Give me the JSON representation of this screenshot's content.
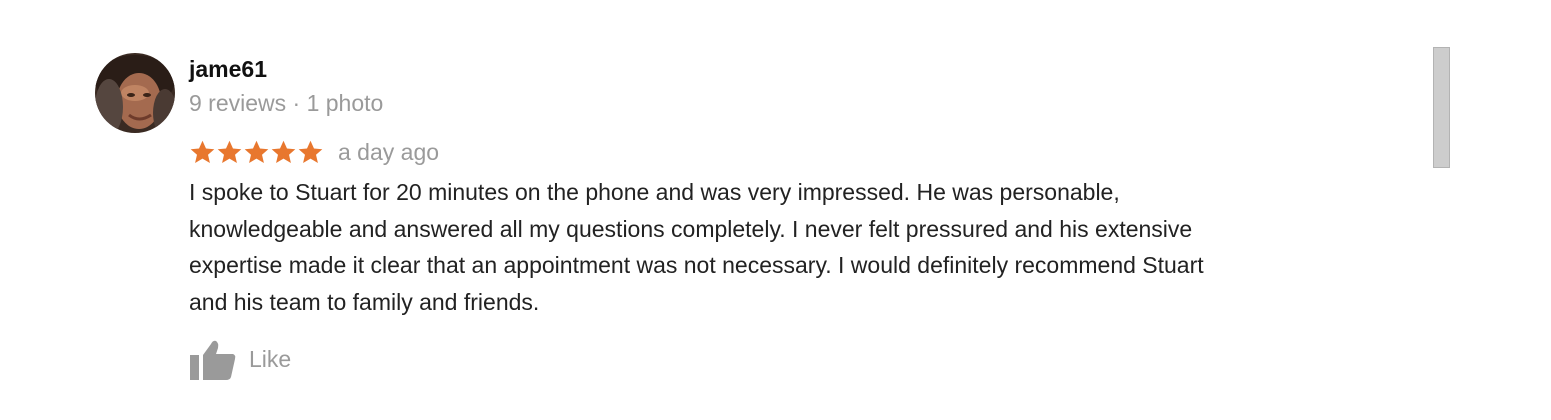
{
  "review": {
    "author_name": "jame61",
    "author_meta": "9 reviews · 1 photo",
    "rating": 5,
    "rating_max": 5,
    "date": "a day ago",
    "text": "I spoke to Stuart for 20 minutes on the phone and was very impressed.  He was personable,\nknowledgeable and answered all my questions completely.  I never felt  pressured and his extensive\nexpertise made it clear that an appointment was not necessary.  I would definitely recommend Stuart\nand his team to family and friends.",
    "like_label": "Like"
  },
  "icons": {
    "avatar": "avatar-photo",
    "star": "star-icon",
    "like": "thumbs-up-icon"
  },
  "colors": {
    "star": "#e8772e",
    "name": "#111111",
    "meta": "#9a9a9a",
    "body_text": "#222222",
    "like": "#9a9a9a",
    "scrollbar": "#cdcdcd"
  }
}
